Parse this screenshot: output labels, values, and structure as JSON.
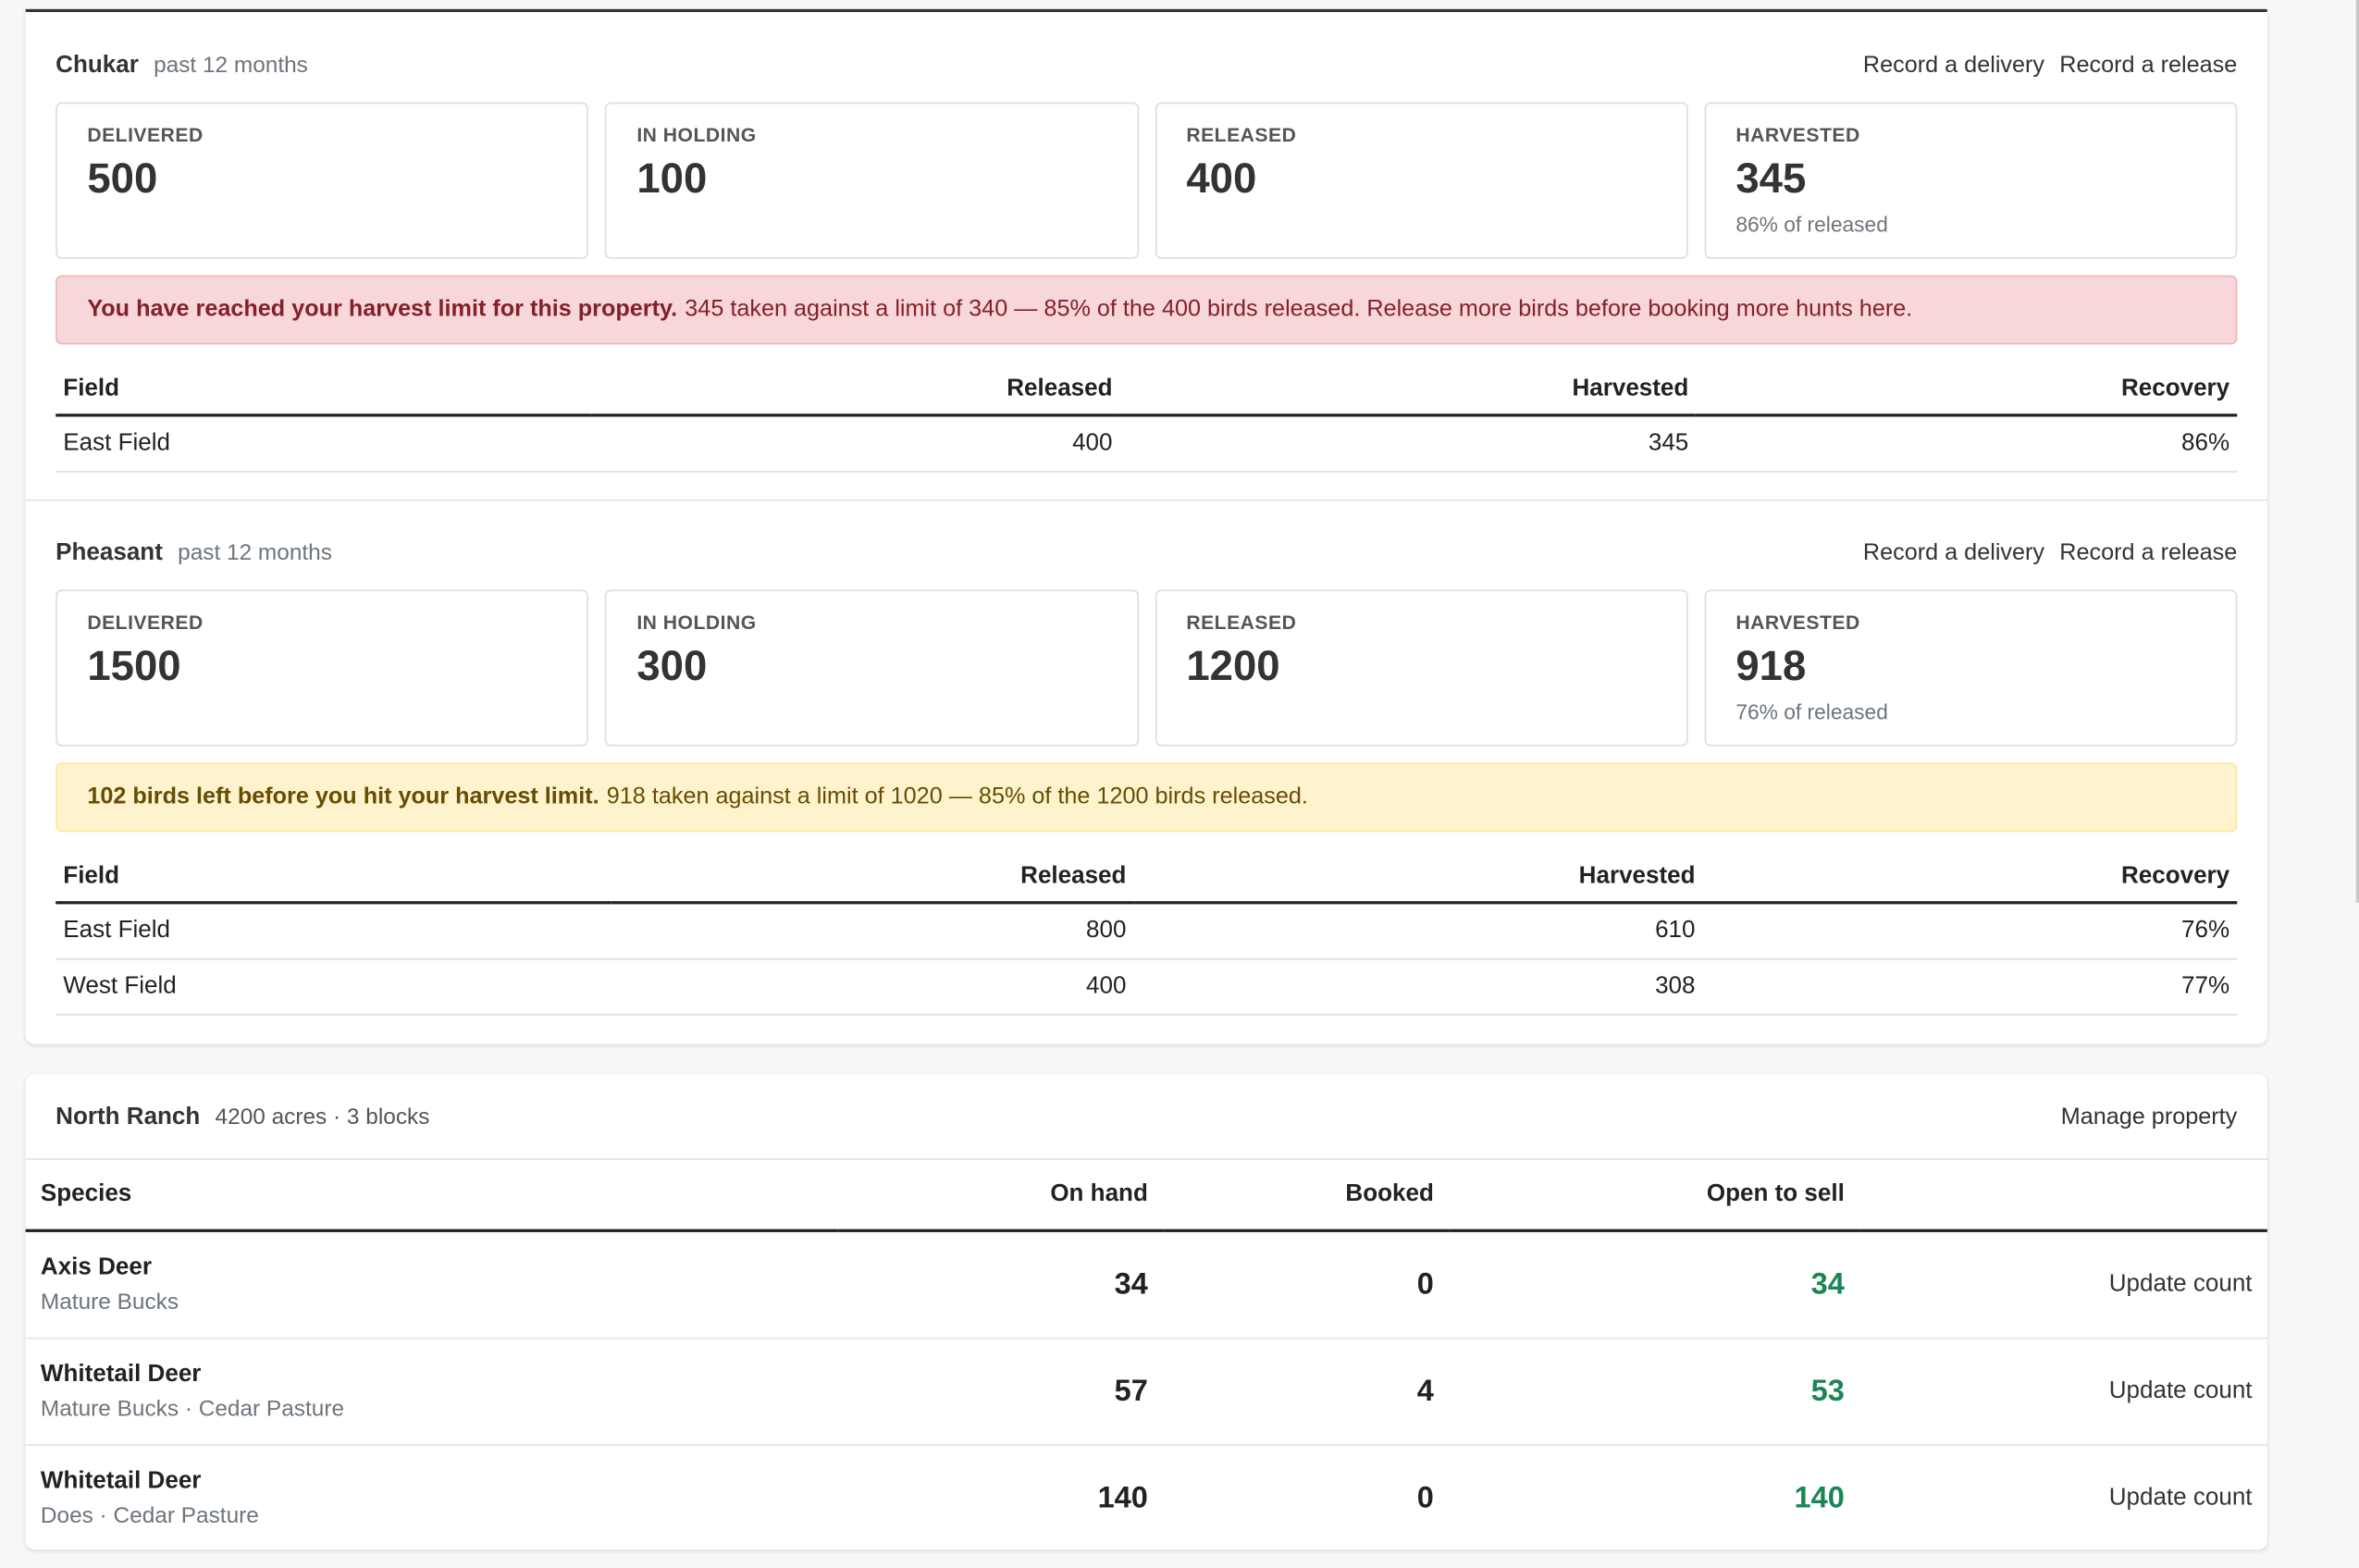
{
  "chukar": {
    "name": "Chukar",
    "period": "past 12 months",
    "record_delivery": "Record a delivery",
    "record_release": "Record a release",
    "stats": [
      {
        "label": "DELIVERED",
        "value": "500",
        "sub": ""
      },
      {
        "label": "IN HOLDING",
        "value": "100",
        "sub": ""
      },
      {
        "label": "RELEASED",
        "value": "400",
        "sub": ""
      },
      {
        "label": "HARVESTED",
        "value": "345",
        "sub": "86% of released"
      }
    ],
    "alert_bold": "You have reached your harvest limit for this property.",
    "alert_text": "345 taken against a limit of 340 — 85% of the 400 birds released. Release more birds before booking more hunts here.",
    "headers": [
      "Field",
      "Released",
      "Harvested",
      "Recovery"
    ],
    "rows": [
      [
        "East Field",
        "400",
        "345",
        "86%"
      ]
    ]
  },
  "pheasant": {
    "name": "Pheasant",
    "period": "past 12 months",
    "record_delivery": "Record a delivery",
    "record_release": "Record a release",
    "stats": [
      {
        "label": "DELIVERED",
        "value": "1500",
        "sub": ""
      },
      {
        "label": "IN HOLDING",
        "value": "300",
        "sub": ""
      },
      {
        "label": "RELEASED",
        "value": "1200",
        "sub": ""
      },
      {
        "label": "HARVESTED",
        "value": "918",
        "sub": "76% of released"
      }
    ],
    "alert_bold": "102 birds left before you hit your harvest limit.",
    "alert_text": "918 taken against a limit of 1020 — 85% of the 1200 birds released.",
    "headers": [
      "Field",
      "Released",
      "Harvested",
      "Recovery"
    ],
    "rows": [
      [
        "East Field",
        "800",
        "610",
        "76%"
      ],
      [
        "West Field",
        "400",
        "308",
        "77%"
      ]
    ]
  },
  "ranch": {
    "name": "North Ranch",
    "meta": "4200 acres · 3 blocks",
    "manage": "Manage property",
    "headers": [
      "Species",
      "On hand",
      "Booked",
      "Open to sell"
    ],
    "update_label": "Update count",
    "rows": [
      {
        "name": "Axis Deer",
        "detail": "Mature Bucks",
        "on_hand": "34",
        "booked": "0",
        "open": "34"
      },
      {
        "name": "Whitetail Deer",
        "detail": "Mature Bucks · Cedar Pasture",
        "on_hand": "57",
        "booked": "4",
        "open": "53"
      },
      {
        "name": "Whitetail Deer",
        "detail": "Does · Cedar Pasture",
        "on_hand": "140",
        "booked": "0",
        "open": "140"
      }
    ]
  }
}
